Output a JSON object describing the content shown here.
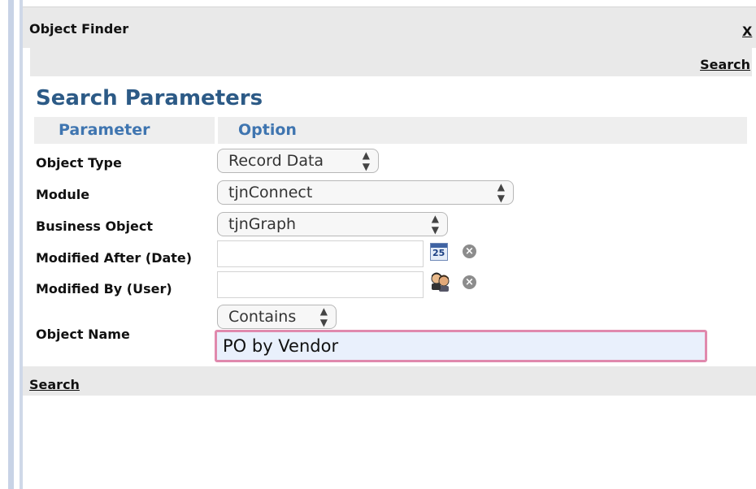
{
  "dialog": {
    "title": "Object Finder",
    "close_label": "X"
  },
  "toolbar": {
    "search_label": "Search"
  },
  "section": {
    "heading": "Search Parameters",
    "col_parameter": "Parameter",
    "col_option": "Option"
  },
  "fields": {
    "object_type": {
      "label": "Object Type",
      "value": "Record Data"
    },
    "module": {
      "label": "Module",
      "value": "tjnConnect"
    },
    "business_object": {
      "label": "Business Object",
      "value": "tjnGraph"
    },
    "modified_after": {
      "label": "Modified After (Date)",
      "value": "",
      "calendar_day": "25"
    },
    "modified_by": {
      "label": "Modified By (User)",
      "value": ""
    },
    "object_name": {
      "label": "Object Name",
      "match_mode": "Contains",
      "value": "PO by Vendor"
    }
  },
  "footer": {
    "search_label": "Search"
  },
  "icons": {
    "select_arrows": "updown-arrows-icon",
    "calendar": "calendar-icon",
    "clear": "clear-icon",
    "user": "users-icon"
  },
  "colors": {
    "heading": "#2c5a86",
    "column_header": "#3f75b0",
    "focus_border": "#e089ad",
    "focus_fill": "#e9f0fc",
    "bar_background": "#e9e9e9"
  }
}
